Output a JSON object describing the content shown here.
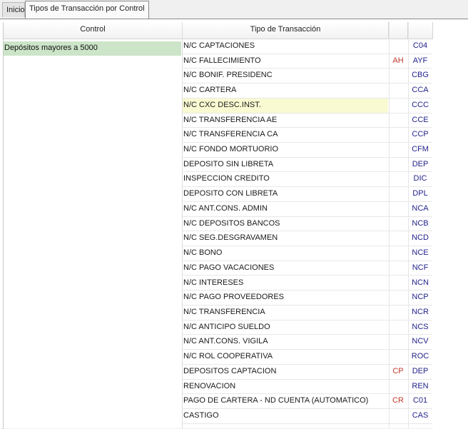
{
  "tabs": [
    {
      "label": "Inicio"
    },
    {
      "label": "Tipos de Transacción por Control"
    }
  ],
  "table": {
    "headers": {
      "control": "Control",
      "tipo": "Tipo de Transacción"
    },
    "control_value": "Depósitos mayores a 5000",
    "selected_row_index": 4,
    "rows": [
      {
        "tipo": "N/C CAPTACIONES",
        "flag": "",
        "code": "C04"
      },
      {
        "tipo": "N/C FALLECIMIENTO",
        "flag": "AH",
        "code": "AYF"
      },
      {
        "tipo": "N/C BONIF. PRESIDENC",
        "flag": "",
        "code": "CBG"
      },
      {
        "tipo": "N/C CARTERA",
        "flag": "",
        "code": "CCA"
      },
      {
        "tipo": "N/C CXC DESC.INST.",
        "flag": "",
        "code": "CCC"
      },
      {
        "tipo": "N/C TRANSFERENCIA AE",
        "flag": "",
        "code": "CCE"
      },
      {
        "tipo": "N/C TRANSFERENCIA CA",
        "flag": "",
        "code": "CCP"
      },
      {
        "tipo": "N/C FONDO MORTUORIO",
        "flag": "",
        "code": "CFM"
      },
      {
        "tipo": "DEPOSITO SIN LIBRETA",
        "flag": "",
        "code": "DEP"
      },
      {
        "tipo": "INSPECCION CREDITO",
        "flag": "",
        "code": "DIC"
      },
      {
        "tipo": "DEPOSITO CON LIBRETA",
        "flag": "",
        "code": "DPL"
      },
      {
        "tipo": "N/C ANT.CONS. ADMIN",
        "flag": "",
        "code": "NCA"
      },
      {
        "tipo": "N/C DEPOSITOS BANCOS",
        "flag": "",
        "code": "NCB"
      },
      {
        "tipo": "N/C SEG.DESGRAVAMEN",
        "flag": "",
        "code": "NCD"
      },
      {
        "tipo": "N/C BONO",
        "flag": "",
        "code": "NCE"
      },
      {
        "tipo": "N/C PAGO VACACIONES",
        "flag": "",
        "code": "NCF"
      },
      {
        "tipo": "N/C INTERESES",
        "flag": "",
        "code": "NCN"
      },
      {
        "tipo": "N/C PAGO PROVEEDORES",
        "flag": "",
        "code": "NCP"
      },
      {
        "tipo": "N/C TRANSFERENCIA",
        "flag": "",
        "code": "NCR"
      },
      {
        "tipo": "N/C ANTICIPO SUELDO",
        "flag": "",
        "code": "NCS"
      },
      {
        "tipo": "N/C ANT.CONS. VIGILA",
        "flag": "",
        "code": "NCV"
      },
      {
        "tipo": "N/C ROL COOPERATIVA",
        "flag": "",
        "code": "ROC"
      },
      {
        "tipo": "DEPOSITOS CAPTACION",
        "flag": "CP",
        "code": "DEP"
      },
      {
        "tipo": "RENOVACION",
        "flag": "",
        "code": "REN"
      },
      {
        "tipo": "PAGO DE CARTERA - ND CUENTA (AUTOMATICO)",
        "flag": "CR",
        "code": "C01"
      },
      {
        "tipo": "CASTIGO",
        "flag": "",
        "code": "CAS"
      }
    ]
  }
}
